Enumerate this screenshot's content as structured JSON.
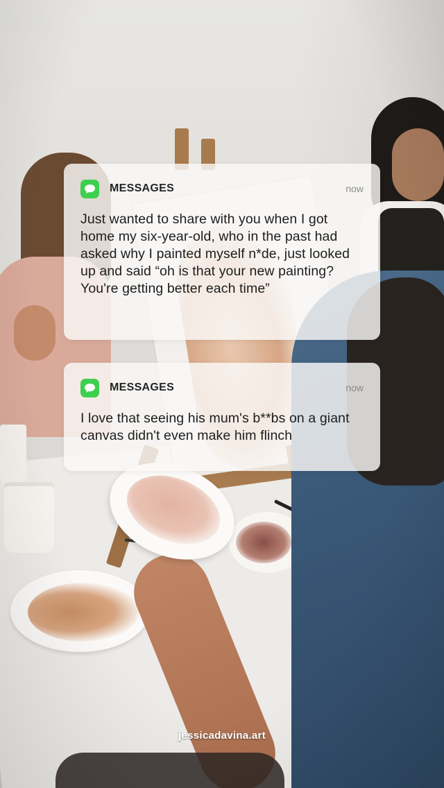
{
  "notifications": [
    {
      "app_name": "MESSAGES",
      "app_icon": "messages-bubble-icon",
      "icon_color": "#3ecf4f",
      "timestamp": "now",
      "body": "Just wanted to share with you when I got home my six-year-old, who in the past had asked why I painted myself n*de, just looked up and said “oh is that your new painting? You're getting better each time”"
    },
    {
      "app_name": "MESSAGES",
      "app_icon": "messages-bubble-icon",
      "icon_color": "#3ecf4f",
      "timestamp": "now",
      "body": "I love that seeing his mum's b**bs on a giant canvas didn't even make him flinch"
    }
  ],
  "watermark": "jessicadavina.art"
}
